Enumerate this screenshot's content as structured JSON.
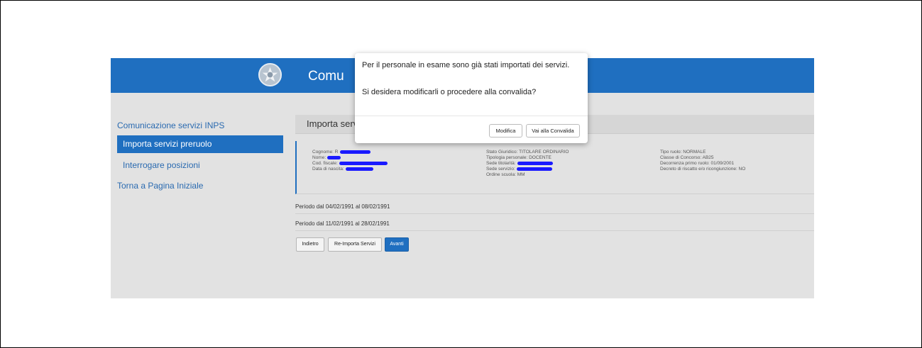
{
  "header": {
    "title": "Comu"
  },
  "sidebar": {
    "heading": "Comunicazione servizi INPS",
    "active_item": "Importa servizi preruolo",
    "item": "Interrogare posizioni",
    "home": "Torna a Pagina Iniziale"
  },
  "main": {
    "panel_title": "Importa servi",
    "info": {
      "col1": [
        "Cognome: R",
        "Nome:",
        "Cod. fiscale:",
        "Data di nascita:"
      ],
      "col2": [
        "Stato Giuridico: TITOLARE ORDINARIO",
        "Tipologia personale: DOCENTE",
        "Sede titolarità:",
        "Sede servizio:",
        "Ordine scuola: MM"
      ],
      "col3": [
        "Tipo ruolo: NORMALE",
        "Classe di Concorso: AB25",
        "Decorrenza primo ruolo: 01/09/2001",
        "Decreto di riscatto e/o ricongiunzione: NO"
      ]
    },
    "periods": [
      "Periodo dal 04/02/1991 al 08/02/1991",
      "Periodo dal 11/02/1991 al 28/02/1991"
    ],
    "buttons": {
      "back": "Indietro",
      "reimport": "Re-Importa Servizi",
      "next": "Avanti"
    }
  },
  "modal": {
    "message_line1": "Per il personale in esame sono già stati importati dei servizi.",
    "message_line2": "Si desidera modificarli o procedere alla convalida?",
    "modify": "Modifica",
    "go_convalida": "Vai alla Convalida"
  }
}
